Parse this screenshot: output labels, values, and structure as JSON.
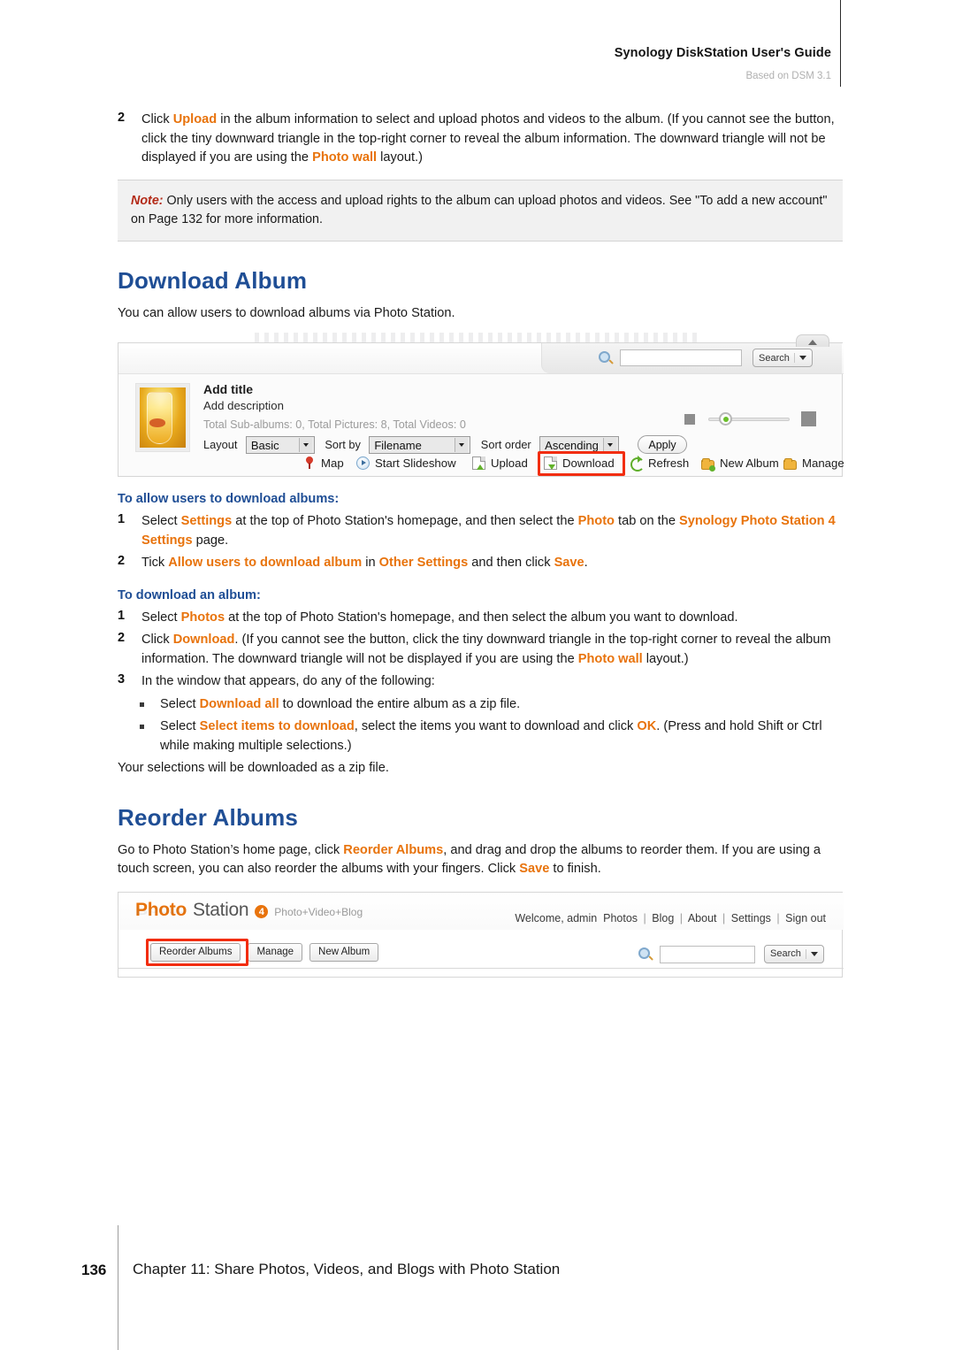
{
  "header": {
    "title": "Synology DiskStation User's Guide",
    "subtitle": "Based on DSM 3.1"
  },
  "top_step": {
    "number": "2",
    "part1": "Click ",
    "kw1": "Upload",
    "part2": " in the album information to select and upload photos and videos to the album. (If you cannot see the button, click the tiny downward triangle in the top-right corner to reveal the album information. The downward triangle will not be displayed if you are using the ",
    "kw2": "Photo wall",
    "part3": " layout.)"
  },
  "note": {
    "label": "Note:",
    "text": " Only users with the access and upload rights to the album can upload photos and videos. See \"To add a new account\" on Page 132 for more information."
  },
  "download_album": {
    "heading": "Download Album",
    "intro": "You can allow users to download albums via Photo Station.",
    "subhead_allow": "To allow users to download albums:",
    "allow_steps": [
      {
        "number": "1",
        "part1": "Select ",
        "kw1": "Settings",
        "part2": " at the top of Photo Station's homepage, and then select the ",
        "kw2": "Photo",
        "part3": " tab on the ",
        "kw3": "Synology Photo Station 4 Settings",
        "part4": " page."
      },
      {
        "number": "2",
        "part1": "Tick ",
        "kw1": "Allow users to download album",
        "part2": " in ",
        "kw2": "Other Settings",
        "part3": " and then click ",
        "kw3": "Save",
        "part4": "."
      }
    ],
    "subhead_download": "To download an album:",
    "download_steps": [
      {
        "number": "1",
        "part1": "Select ",
        "kw1": "Photos",
        "part2": " at the top of Photo Station's homepage, and then select the album you want to download."
      },
      {
        "number": "2",
        "part1": "Click ",
        "kw1": "Download",
        "part2": ". (If you cannot see the button, click the tiny downward triangle in the top-right corner to reveal the album information. The downward triangle will not be displayed if you are using the ",
        "kw2": "Photo wall",
        "part3": " layout.)"
      },
      {
        "number": "3",
        "part1": "In the window that appears, do any of the following:"
      }
    ],
    "bullets": [
      {
        "part1": "Select ",
        "kw1": "Download all",
        "part2": " to download the entire album as a zip file."
      },
      {
        "part1": "Select ",
        "kw1": "Select items to download",
        "part2": ", select the items you want to download and click ",
        "kw2": "OK",
        "part3": ". (Press and hold Shift or Ctrl while making multiple selections.)"
      }
    ],
    "closing": "Your selections will be downloaded as a zip file."
  },
  "reorder_albums": {
    "heading": "Reorder Albums",
    "part1": "Go to Photo Station’s home page, click ",
    "kw1": "Reorder Albums",
    "part2": ", and drag and drop the albums to reorder them. If you are using a touch screen, you can also reorder the albums with your fingers. Click ",
    "kw2": "Save",
    "part3": " to finish."
  },
  "screenshot_album": {
    "album_title": "Add title",
    "album_description": "Add description",
    "stats": "Total Sub-albums: 0, Total Pictures: 8, Total Videos: 0",
    "layout_label": "Layout",
    "layout_value": "Basic",
    "sortby_label": "Sort by",
    "sortby_value": "Filename",
    "sortorder_label": "Sort order",
    "sortorder_value": "Ascending",
    "apply_label": "Apply",
    "search_value": "",
    "search_button": "Search",
    "toolbar": [
      {
        "label": "Map",
        "icon": "map-pin-icon"
      },
      {
        "label": "Start Slideshow",
        "icon": "play-icon"
      },
      {
        "label": "Upload",
        "icon": "upload-icon"
      },
      {
        "label": "Download",
        "icon": "download-icon"
      },
      {
        "label": "Refresh",
        "icon": "refresh-icon"
      },
      {
        "label": "New Album",
        "icon": "new-folder-icon"
      },
      {
        "label": "Manage",
        "icon": "folder-icon"
      }
    ],
    "highlighted_button": "Download"
  },
  "screenshot_home": {
    "brand_word1": "Photo",
    "brand_word2": "Station",
    "brand_version": "4",
    "brand_tagline": "Photo+Video+Blog",
    "welcome": "Welcome, admin",
    "nav": [
      "Photos",
      "Blog",
      "About",
      "Settings",
      "Sign out"
    ],
    "nav_separator": "|",
    "buttons": [
      "Reorder Albums",
      "Manage",
      "New Album"
    ],
    "highlighted_button": "Reorder Albums",
    "search_value": "",
    "search_button": "Search"
  },
  "footer": {
    "page_number": "136",
    "chapter": "Chapter 11: Share Photos, Videos, and Blogs with Photo Station"
  },
  "colors": {
    "heading_blue": "#1f4e95",
    "keyword_orange": "#e8730c",
    "highlight_red": "#f22d0f",
    "note_red": "#b32a17"
  }
}
